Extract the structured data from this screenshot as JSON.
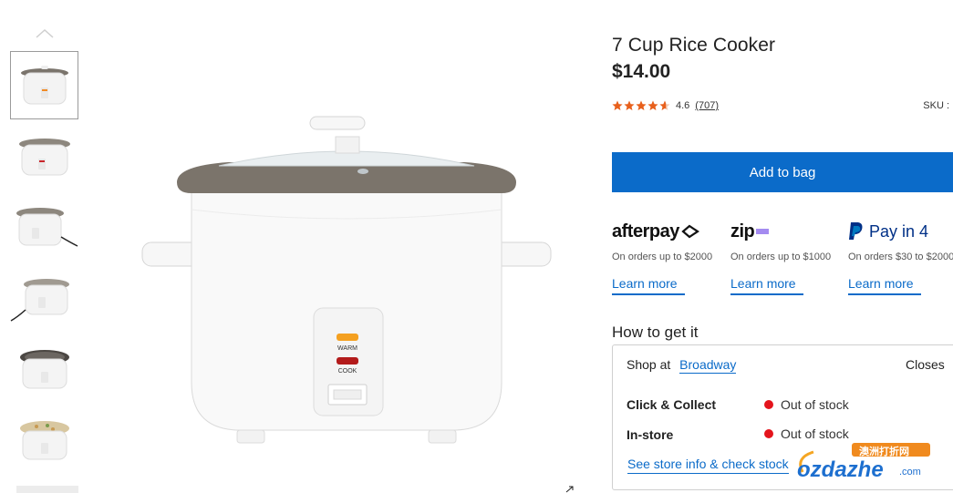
{
  "gallery": {
    "up_icon": "chevron-up-icon",
    "thumbnails": [
      {
        "alt": "rice-cooker-front",
        "active": true
      },
      {
        "alt": "rice-cooker-angle"
      },
      {
        "alt": "rice-cooker-side-cord"
      },
      {
        "alt": "rice-cooker-open"
      },
      {
        "alt": "rice-cooker-dark-lid"
      },
      {
        "alt": "rice-cooker-with-rice"
      }
    ]
  },
  "product": {
    "title": "7 Cup Rice Cooker",
    "price": "$14.00",
    "rating": "4.6",
    "review_count": "(707)",
    "stars": 4.6,
    "star_color": "#e8601c",
    "sku_label": "SKU :",
    "add_to_bag": "Add to bag",
    "brand_blue": "#0b6bc9",
    "warm_label": "WARM",
    "cook_label": "COOK"
  },
  "payments": [
    {
      "name": "afterpay",
      "text": "On orders up to $2000",
      "link": "Learn more"
    },
    {
      "name": "zip",
      "text": "On orders up to $1000",
      "link": "Learn more"
    },
    {
      "name": "Pay in 4",
      "text": "On orders $30 to $2000",
      "link": "Learn more"
    }
  ],
  "fulfilment": {
    "heading": "How to get it",
    "shop_at": "Shop at",
    "store": "Broadway",
    "closes": "Closes",
    "click_collect_label": "Click & Collect",
    "click_collect_status": "Out of stock",
    "instore_label": "In-store",
    "instore_status": "Out of stock",
    "see_store": "See store info & check stock",
    "status_color": "#e4141c"
  },
  "watermark": {
    "top": "澳洲打折网",
    "brand": "ozdazhe",
    "suffix": ".com"
  }
}
